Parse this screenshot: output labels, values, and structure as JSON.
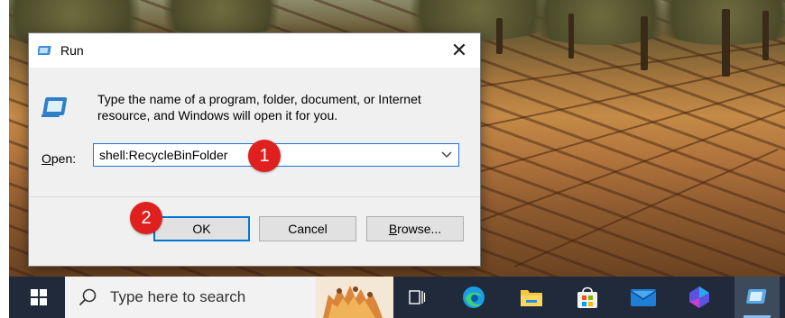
{
  "dialog": {
    "title": "Run",
    "description": "Type the name of a program, folder, document, or Internet resource, and Windows will open it for you.",
    "open_label_prefix": "",
    "open_label_accel": "O",
    "open_label_rest": "pen:",
    "open_value": "shell:RecycleBinFolder",
    "ok_label": "OK",
    "cancel_label": "Cancel",
    "browse_accel": "B",
    "browse_rest": "rowse...",
    "close_glyph": "✕"
  },
  "callouts": [
    "1",
    "2"
  ],
  "taskbar": {
    "search_placeholder": "Type here to search",
    "icons": [
      "windows-start-icon",
      "search-icon",
      "task-view-icon",
      "edge-icon",
      "file-explorer-icon",
      "microsoft-store-icon",
      "mail-icon",
      "copilot-icon",
      "run-app-icon"
    ]
  },
  "colors": {
    "accent": "#0078d7",
    "callout": "#e0201e",
    "taskbar": "#202a3a"
  }
}
